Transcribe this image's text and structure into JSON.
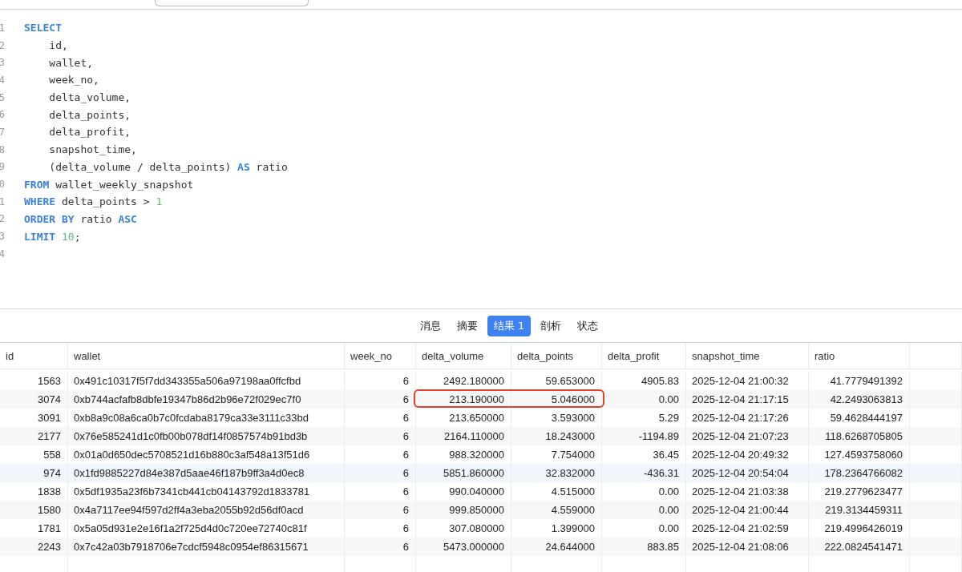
{
  "editor": {
    "lines": [
      {
        "number": "1",
        "tokens": [
          {
            "text": "SELECT",
            "kind": "keyword"
          }
        ]
      },
      {
        "number": "2",
        "tokens": [
          {
            "text": "    id,",
            "kind": "plain"
          }
        ]
      },
      {
        "number": "3",
        "tokens": [
          {
            "text": "    wallet,",
            "kind": "plain"
          }
        ]
      },
      {
        "number": "4",
        "tokens": [
          {
            "text": "    week_no,",
            "kind": "plain"
          }
        ]
      },
      {
        "number": "5",
        "tokens": [
          {
            "text": "    delta_volume,",
            "kind": "plain"
          }
        ]
      },
      {
        "number": "6",
        "tokens": [
          {
            "text": "    delta_points,",
            "kind": "plain"
          }
        ]
      },
      {
        "number": "7",
        "tokens": [
          {
            "text": "    delta_profit,",
            "kind": "plain"
          }
        ]
      },
      {
        "number": "8",
        "tokens": [
          {
            "text": "    snapshot_time,",
            "kind": "plain"
          }
        ]
      },
      {
        "number": "9",
        "tokens": [
          {
            "text": "    (delta_volume / delta_points) ",
            "kind": "plain"
          },
          {
            "text": "AS",
            "kind": "keyword"
          },
          {
            "text": " ratio",
            "kind": "plain"
          }
        ]
      },
      {
        "number": "0",
        "tokens": [
          {
            "text": "FROM",
            "kind": "keyword"
          },
          {
            "text": " wallet_weekly_snapshot",
            "kind": "plain"
          }
        ]
      },
      {
        "number": "1",
        "tokens": [
          {
            "text": "WHERE",
            "kind": "keyword"
          },
          {
            "text": " delta_points > ",
            "kind": "plain"
          },
          {
            "text": "1",
            "kind": "number"
          }
        ]
      },
      {
        "number": "2",
        "tokens": [
          {
            "text": "ORDER BY",
            "kind": "keyword"
          },
          {
            "text": " ratio ",
            "kind": "plain"
          },
          {
            "text": "ASC",
            "kind": "keyword"
          }
        ]
      },
      {
        "number": "3",
        "tokens": [
          {
            "text": "LIMIT",
            "kind": "keyword"
          },
          {
            "text": " 10",
            "kind": "number"
          },
          {
            "text": ";",
            "kind": "plain"
          }
        ]
      },
      {
        "number": "4"
      }
    ]
  },
  "result_tabs": [
    {
      "label": "消息",
      "selected": false
    },
    {
      "label": "摘要",
      "selected": false
    },
    {
      "label": "结果 1",
      "selected": true
    },
    {
      "label": "剖析",
      "selected": false
    },
    {
      "label": "状态",
      "selected": false
    }
  ],
  "table": {
    "columns": [
      "id",
      "wallet",
      "week_no",
      "delta_volume",
      "delta_points",
      "delta_profit",
      "snapshot_time",
      "ratio"
    ],
    "rows": [
      {
        "selected": false,
        "highlighted": false,
        "cells": [
          "1563",
          "0x491c10317f5f7dd343355a506a97198aa0ffcfbd",
          "6",
          "2492.180000",
          "59.653000",
          "4905.83",
          "2025-12-04 21:00:32",
          "41.7779491392"
        ]
      },
      {
        "selected": false,
        "highlighted": true,
        "cells": [
          "3074",
          "0xb744acfafb8dbfe19347b86d2b96e72f029ec7f0",
          "6",
          "213.190000",
          "5.046000",
          "0.00",
          "2025-12-04 21:17:15",
          "42.2493063813"
        ]
      },
      {
        "selected": false,
        "highlighted": false,
        "cells": [
          "3091",
          "0xb8a9c08a6ca0b7c0fcdaba8179ca33e3111c33bd",
          "6",
          "213.650000",
          "3.593000",
          "5.29",
          "2025-12-04 21:17:26",
          "59.4628444197"
        ]
      },
      {
        "selected": false,
        "highlighted": false,
        "cells": [
          "2177",
          "0x76e585241d1c0fb00b078df14f0857574b91bd3b",
          "6",
          "2164.110000",
          "18.243000",
          "-1194.89",
          "2025-12-04 21:07:23",
          "118.6268705805"
        ]
      },
      {
        "selected": false,
        "highlighted": false,
        "cells": [
          "558",
          "0x01a0d650dec5708521d16b880c3af548a13f51d6",
          "6",
          "988.320000",
          "7.754000",
          "36.45",
          "2025-12-04 20:49:32",
          "127.4593758060"
        ]
      },
      {
        "selected": true,
        "highlighted": false,
        "cells": [
          "974",
          "0x1fd9885227d84e387d5aae46f187b9ff3a4d0ec8",
          "6",
          "5851.860000",
          "32.832000",
          "-436.31",
          "2025-12-04 20:54:04",
          "178.2364766082"
        ]
      },
      {
        "selected": false,
        "highlighted": false,
        "cells": [
          "1838",
          "0x5df1935a23f6b7341cb441cb04143792d1833781",
          "6",
          "990.040000",
          "4.515000",
          "0.00",
          "2025-12-04 21:03:38",
          "219.2779623477"
        ]
      },
      {
        "selected": false,
        "highlighted": false,
        "cells": [
          "1580",
          "0x4a7117ee94f597d2ff4a3eba2055b92d56df0acd",
          "6",
          "999.850000",
          "4.559000",
          "0.00",
          "2025-12-04 21:00:44",
          "219.3134459311"
        ]
      },
      {
        "selected": false,
        "highlighted": false,
        "cells": [
          "1781",
          "0x5a05d931e2e16f1a2f725d4d0c720ee72740c81f",
          "6",
          "307.080000",
          "1.399000",
          "0.00",
          "2025-12-04 21:02:59",
          "219.4996426019"
        ]
      },
      {
        "selected": false,
        "highlighted": false,
        "cells": [
          "2243",
          "0x7c42a03b7918706e7cdcf5948c0954ef86315671",
          "6",
          "5473.000000",
          "24.644000",
          "883.85",
          "2025-12-04 21:08:06",
          "222.0824541471"
        ]
      }
    ]
  }
}
